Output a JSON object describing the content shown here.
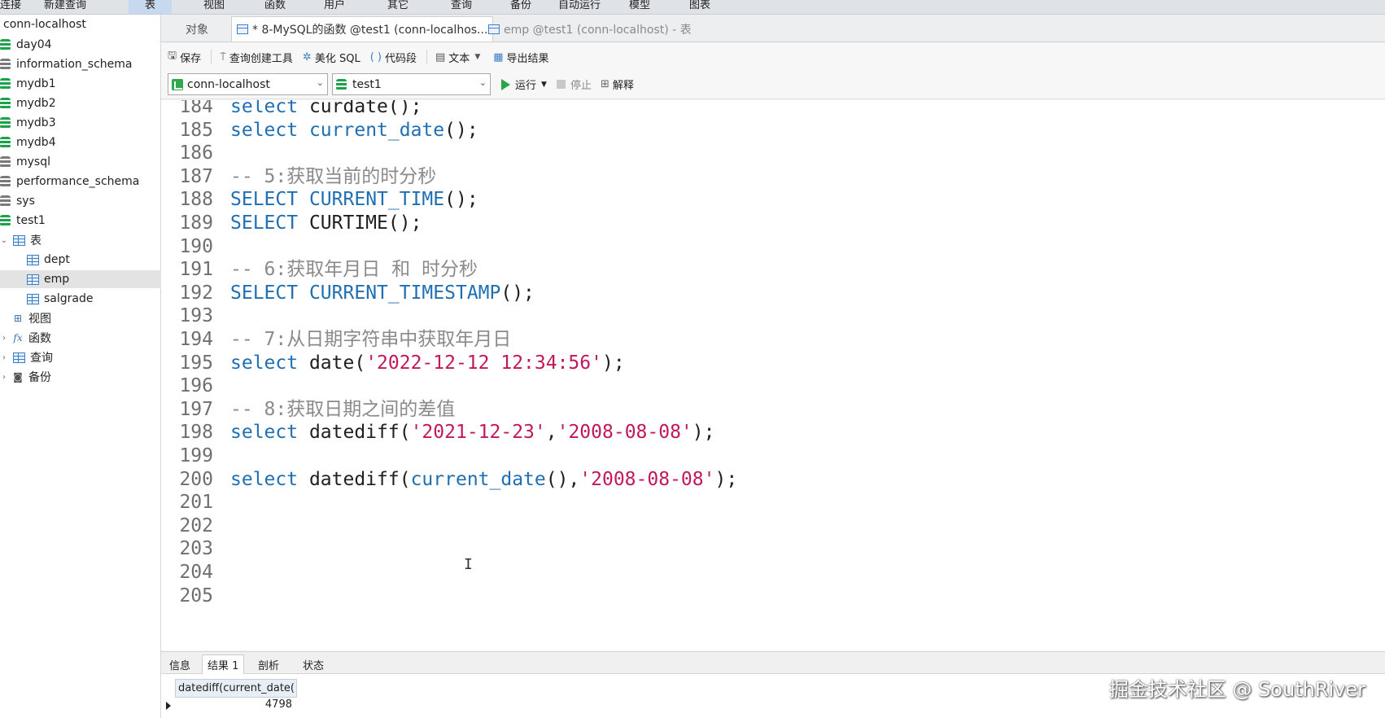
{
  "menu": {
    "items": [
      "连接",
      "新建查询",
      "表",
      "视图",
      "函数",
      "用户",
      "其它",
      "查询",
      "备份",
      "自动运行",
      "模型",
      "图表"
    ],
    "active_index": 2
  },
  "sidebar": {
    "connection": "conn-localhost",
    "databases": [
      {
        "label": "day04",
        "color": "green"
      },
      {
        "label": "information_schema",
        "color": "gray"
      },
      {
        "label": "mydb1",
        "color": "green"
      },
      {
        "label": "mydb2",
        "color": "green"
      },
      {
        "label": "mydb3",
        "color": "green"
      },
      {
        "label": "mydb4",
        "color": "green"
      },
      {
        "label": "mysql",
        "color": "gray"
      },
      {
        "label": "performance_schema",
        "color": "gray"
      },
      {
        "label": "sys",
        "color": "gray"
      },
      {
        "label": "test1",
        "color": "green"
      }
    ],
    "tables_folder": "表",
    "tables": [
      "dept",
      "emp",
      "salgrade"
    ],
    "selected_table": "emp",
    "views_folder": "视图",
    "functions_folder": "函数",
    "queries_folder": "查询",
    "backups_folder": "备份"
  },
  "tabs": {
    "objects": "对象",
    "query_tab": "* 8-MySQL的函数 @test1 (conn-localhos...",
    "table_tab": "emp @test1 (conn-localhost) - 表"
  },
  "toolbar": {
    "save": "保存",
    "query_builder": "查询创建工具",
    "beautify": "美化 SQL",
    "snippet": "代码段",
    "text": "文本",
    "export": "导出结果"
  },
  "selectors": {
    "connection": "conn-localhost",
    "database": "test1",
    "run": "运行",
    "stop": "停止",
    "explain": "解释"
  },
  "editor": {
    "lines": [
      {
        "n": "184",
        "code": "select curdate();"
      },
      {
        "n": "185",
        "code": "select current_date();"
      },
      {
        "n": "186",
        "code": ""
      },
      {
        "n": "187",
        "code": "-- 5:获取当前的时分秒"
      },
      {
        "n": "188",
        "code": "SELECT CURRENT_TIME();"
      },
      {
        "n": "189",
        "code": "SELECT CURTIME();"
      },
      {
        "n": "190",
        "code": ""
      },
      {
        "n": "191",
        "code": "-- 6:获取年月日 和 时分秒"
      },
      {
        "n": "192",
        "code": "SELECT CURRENT_TIMESTAMP();"
      },
      {
        "n": "193",
        "code": ""
      },
      {
        "n": "194",
        "code": "-- 7:从日期字符串中获取年月日"
      },
      {
        "n": "195",
        "code": "select date('2022-12-12 12:34:56');"
      },
      {
        "n": "196",
        "code": ""
      },
      {
        "n": "197",
        "code": "-- 8:获取日期之间的差值"
      },
      {
        "n": "198",
        "code": "select datediff('2021-12-23','2008-08-08');"
      },
      {
        "n": "199",
        "code": ""
      },
      {
        "n": "200",
        "code": "select datediff(current_date(),'2008-08-08');"
      },
      {
        "n": "201",
        "code": ""
      },
      {
        "n": "202",
        "code": ""
      },
      {
        "n": "203",
        "code": ""
      },
      {
        "n": "204",
        "code": ""
      },
      {
        "n": "205",
        "code": ""
      }
    ]
  },
  "results": {
    "tabs": [
      "信息",
      "结果 1",
      "剖析",
      "状态"
    ],
    "active_tab": "结果 1",
    "column": "datediff(current_date(",
    "value": "4798"
  },
  "watermark": "掘金技术社区 @ SouthRiver",
  "colors": {
    "keyword": "#1f6fb2",
    "string": "#c2185b",
    "comment": "#8a8a8a",
    "db_green": "#1aa34a"
  }
}
